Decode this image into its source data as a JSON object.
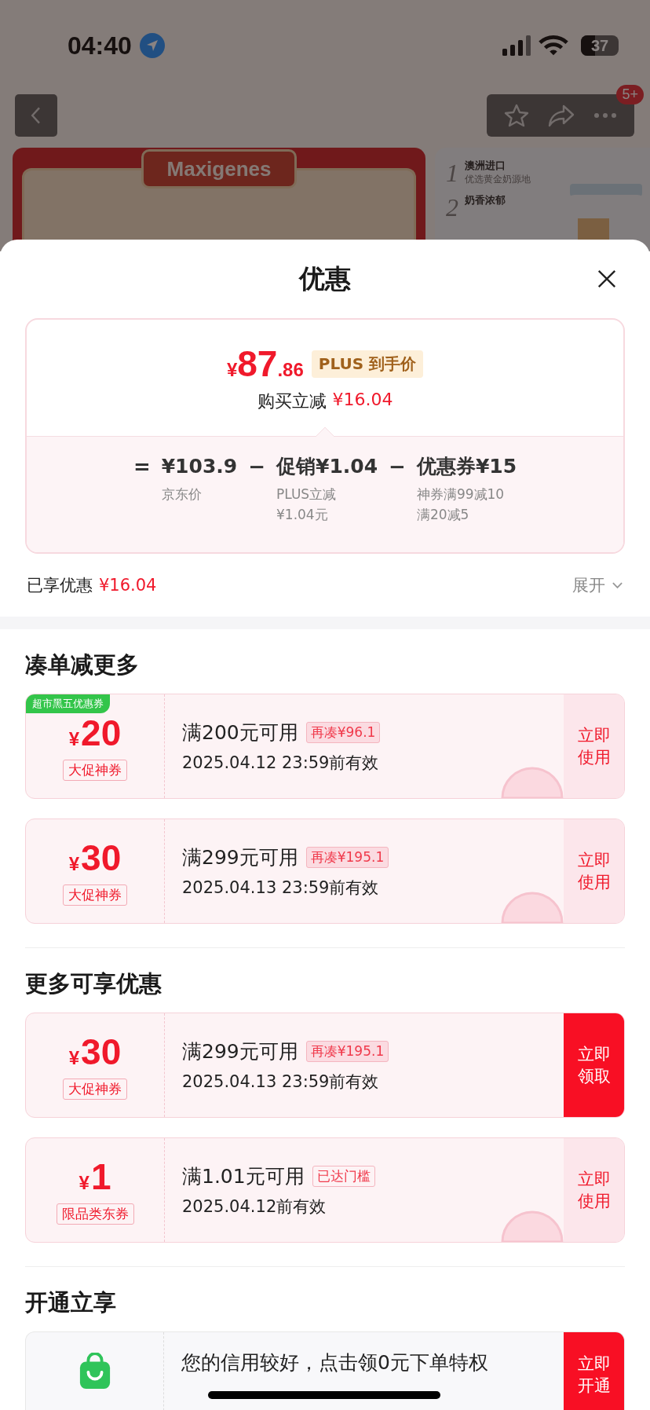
{
  "status_bar": {
    "time": "04:40",
    "battery": "37"
  },
  "nav": {
    "badge": "5+"
  },
  "product": {
    "brand": "Maxigenes",
    "features": [
      {
        "number": "1",
        "title": "澳洲进口",
        "subtitle": "优选黄金奶源地"
      },
      {
        "number": "2",
        "title": "奶香浓郁"
      }
    ]
  },
  "sheet": {
    "title": "优惠",
    "price": {
      "currency": "¥",
      "integer": "87",
      "decimal": ".86",
      "tag": "PLUS 到手价",
      "saving_label": "购买立减",
      "saving_amount": "¥16.04"
    },
    "breakdown": {
      "equals": "=",
      "items": [
        {
          "amount": "¥103.9",
          "notes": [
            "京东价"
          ]
        },
        {
          "amount": "促销¥1.04",
          "notes": [
            "PLUS立减",
            "¥1.04元"
          ]
        },
        {
          "amount": "优惠券¥15",
          "notes": [
            "神券满99减10",
            "满20减5"
          ]
        }
      ],
      "minus": "−"
    },
    "enjoyed": {
      "label": "已享优惠",
      "amount": "¥16.04",
      "expand": "展开"
    },
    "sections": [
      {
        "title": "凑单减更多",
        "coupons": [
          {
            "badge": "超市黑五优惠券",
            "currency": "¥",
            "amount": "20",
            "type": "大促神券",
            "condition": "满200元可用",
            "tag": "再凑¥96.1",
            "tag_filled": true,
            "validity": "2025.04.12 23:59前有效",
            "claimed": true,
            "action": "立即使用"
          },
          {
            "currency": "¥",
            "amount": "30",
            "type": "大促神券",
            "condition": "满299元可用",
            "tag": "再凑¥195.1",
            "tag_filled": true,
            "validity": "2025.04.13 23:59前有效",
            "claimed": true,
            "action": "立即使用"
          }
        ]
      },
      {
        "title": "更多可享优惠",
        "coupons": [
          {
            "currency": "¥",
            "amount": "30",
            "type": "大促神券",
            "condition": "满299元可用",
            "tag": "再凑¥195.1",
            "tag_filled": true,
            "validity": "2025.04.13 23:59前有效",
            "claimed": false,
            "action": "立即领取"
          },
          {
            "currency": "¥",
            "amount": "1",
            "type": "限品类东券",
            "condition": "满1.01元可用",
            "tag": "已达门槛",
            "tag_filled": false,
            "validity": "2025.04.12前有效",
            "claimed": true,
            "action": "立即使用"
          }
        ]
      }
    ],
    "open": {
      "title": "开通立享",
      "text": "您的信用较好，点击领0元下单特权",
      "action": "立即开通"
    }
  }
}
